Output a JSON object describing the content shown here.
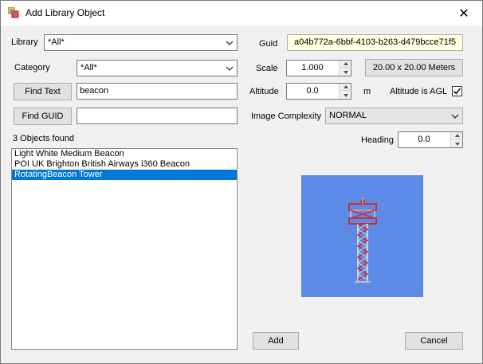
{
  "window": {
    "title": "Add Library Object",
    "close_glyph": "✕"
  },
  "library": {
    "label": "Library",
    "value": "*All*"
  },
  "category": {
    "label": "Category",
    "value": "*All*"
  },
  "find_text": {
    "button_label": "Find Text",
    "value": "beacon"
  },
  "find_guid": {
    "button_label": "Find GUID",
    "value": ""
  },
  "results": {
    "count_text": "3 Objects found",
    "items": [
      {
        "label": "Light White Medium Beacon",
        "selected": false
      },
      {
        "label": "POI UK Brighton British Airways i360 Beacon",
        "selected": false
      },
      {
        "label": "RotatingBeacon Tower",
        "selected": true
      }
    ]
  },
  "guid": {
    "label": "Guid",
    "value": "a04b772a-6bbf-4103-b263-d479bcce71f5"
  },
  "scale": {
    "label": "Scale",
    "value": "1.000",
    "size_button": "20.00 x 20.00 Meters"
  },
  "altitude": {
    "label": "Altitude",
    "value": "0.0",
    "unit": "m",
    "agl_label": "Altitude is AGL",
    "agl_checked": true
  },
  "image_complexity": {
    "label": "Image Complexity",
    "value": "NORMAL"
  },
  "heading": {
    "label": "Heading",
    "value": "0.0"
  },
  "actions": {
    "add_label": "Add",
    "cancel_label": "Cancel"
  },
  "colors": {
    "accent": "#0078d7",
    "preview_bg": "#5b8be6",
    "guid_bg": "#ffffe1",
    "tower_red": "#c8323c"
  },
  "icons": {
    "title": "app-icon",
    "close": "close-icon",
    "chevron": "chevron-down-icon",
    "check": "checkmark-icon"
  }
}
